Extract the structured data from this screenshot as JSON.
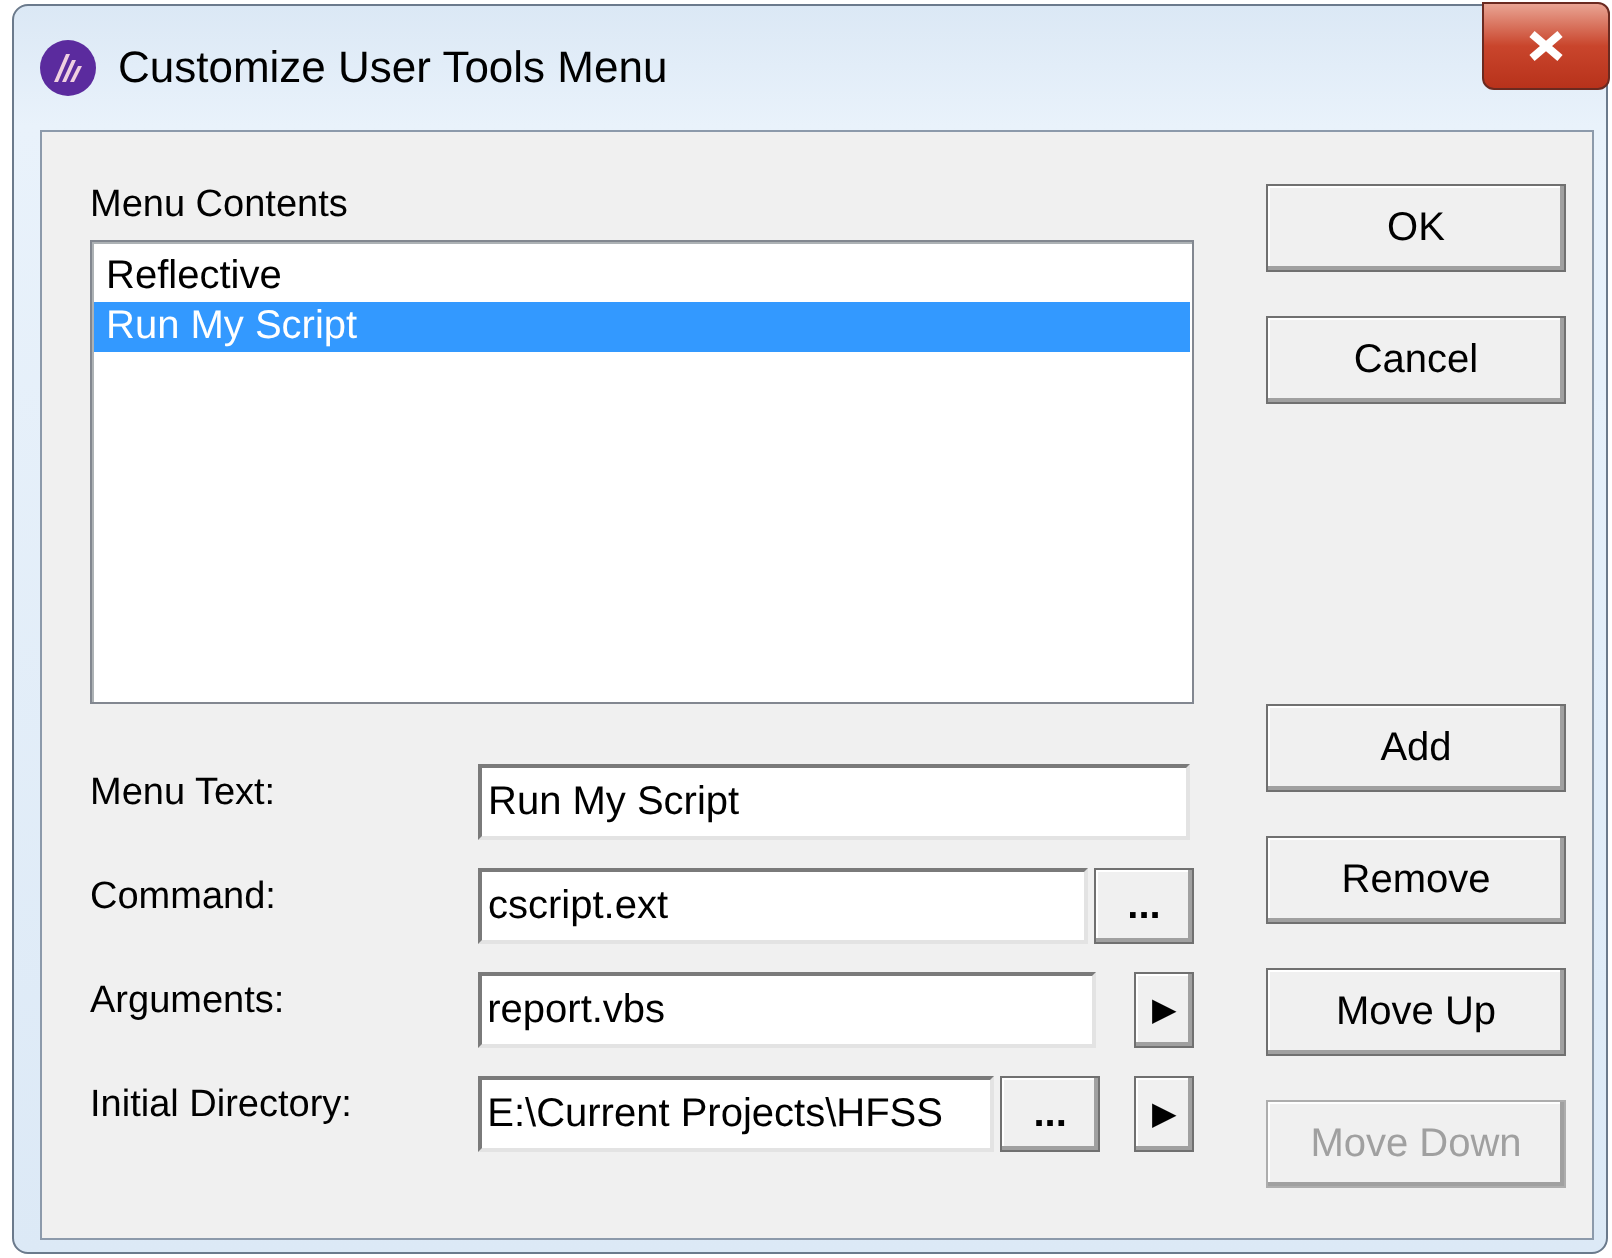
{
  "window": {
    "title": "Customize User Tools Menu"
  },
  "menu_contents": {
    "label": "Menu Contents",
    "items": [
      {
        "text": "Reflective",
        "selected": false
      },
      {
        "text": "Run My Script",
        "selected": true
      }
    ]
  },
  "fields": [
    {
      "label": "Menu Text:",
      "value": "Run My Script",
      "browse": false,
      "arrow": false
    },
    {
      "label": "Command:",
      "value": "cscript.ext",
      "browse": true,
      "arrow": false
    },
    {
      "label": "Arguments:",
      "value": "report.vbs",
      "browse": false,
      "arrow": true
    },
    {
      "label": "Initial Directory:",
      "value": "E:\\Current Projects\\HFSS",
      "browse": true,
      "arrow": true
    }
  ],
  "browse_label": "...",
  "arrow_label": "▶",
  "dialog_buttons": [
    {
      "label": "OK",
      "disabled": false
    },
    {
      "label": "Cancel",
      "disabled": false
    }
  ],
  "list_buttons": [
    {
      "label": "Add",
      "disabled": false
    },
    {
      "label": "Remove",
      "disabled": false
    },
    {
      "label": "Move Up",
      "disabled": false
    },
    {
      "label": "Move Down",
      "disabled": true
    }
  ]
}
